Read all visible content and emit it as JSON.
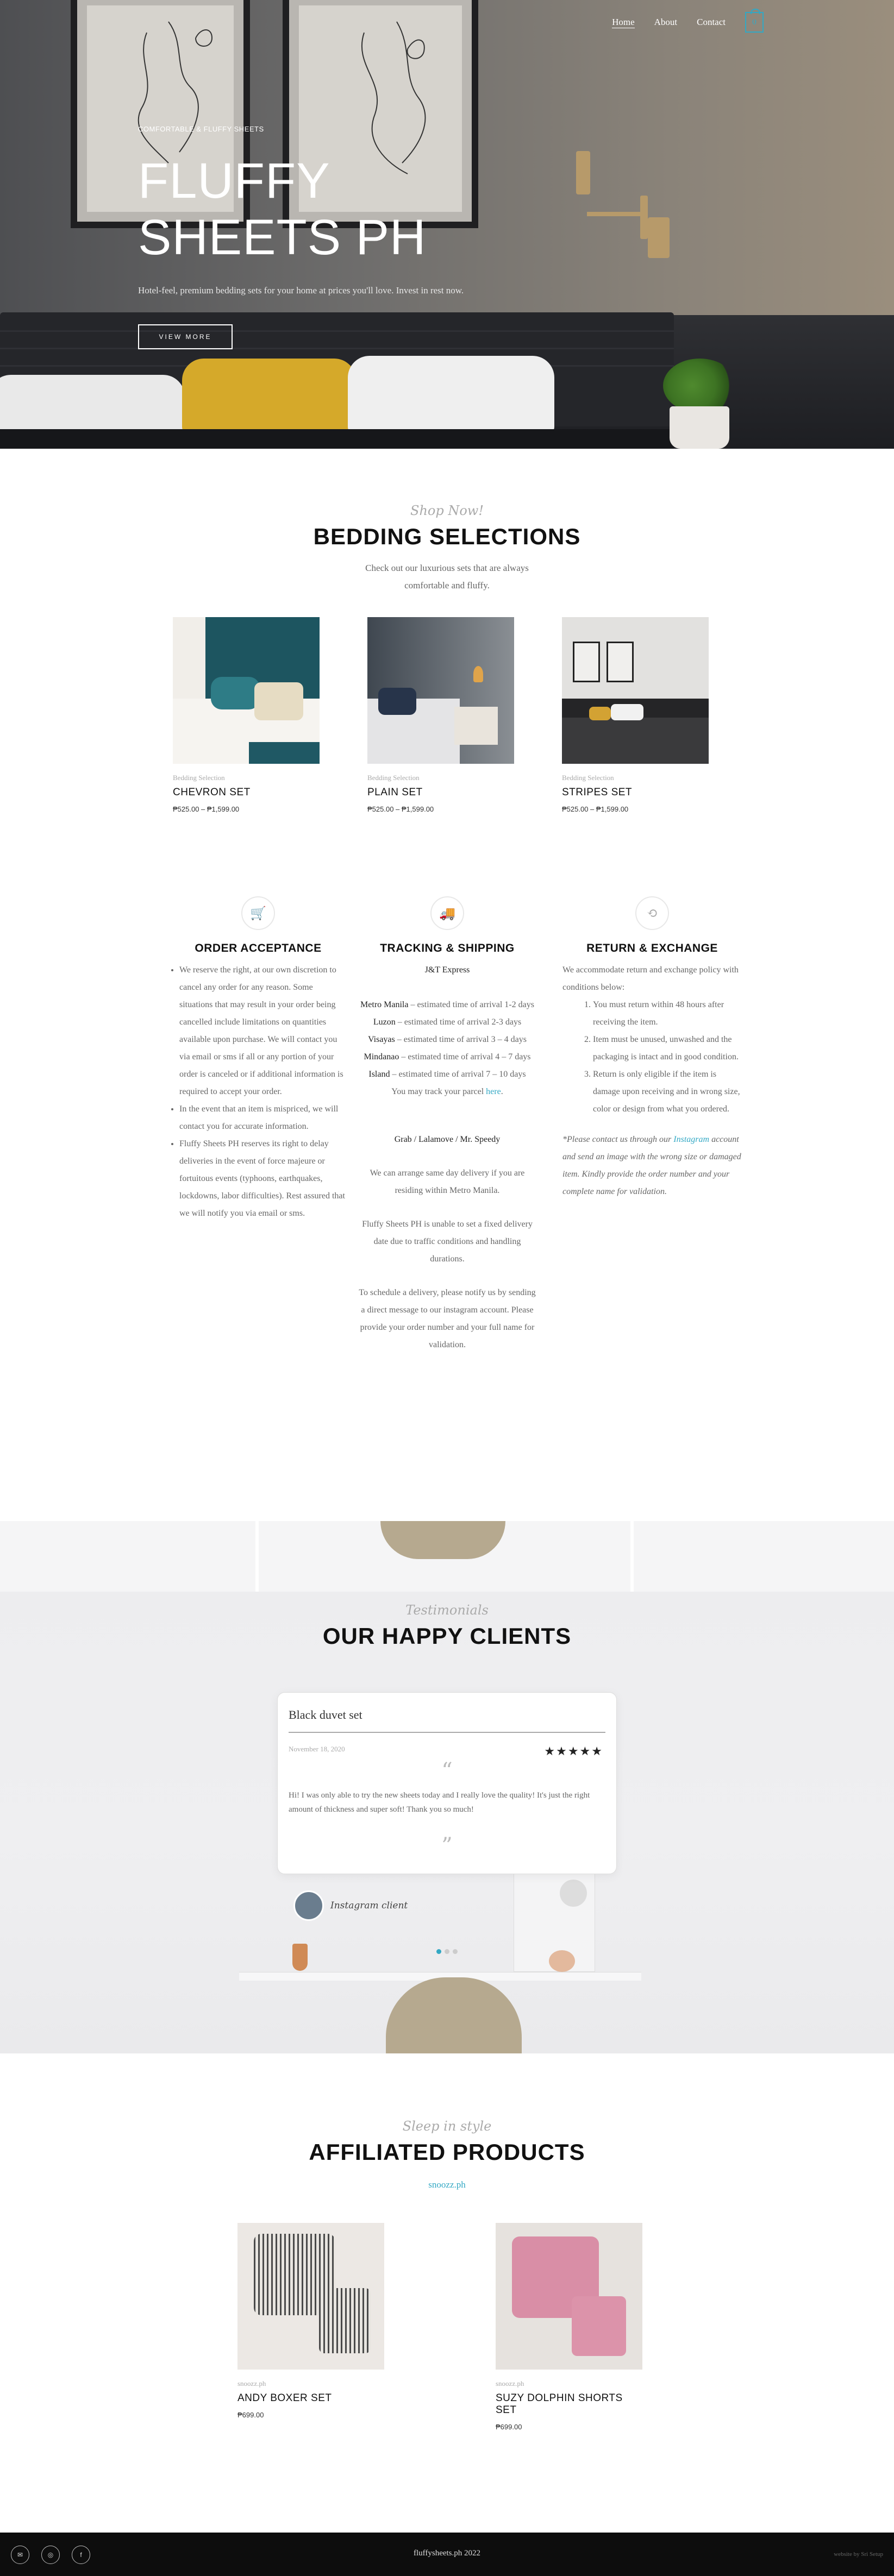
{
  "nav": {
    "items": [
      {
        "label": "Home"
      },
      {
        "label": "About"
      },
      {
        "label": "Contact"
      }
    ],
    "cart_count": "0"
  },
  "hero": {
    "eyebrow": "COMFORTABLE & FLUFFY SHEETS",
    "title": "FLUFFY SHEETS PH",
    "subtitle": "Hotel-feel, premium bedding sets for your home at prices you'll love. Invest in rest now.",
    "button": "VIEW MORE"
  },
  "bedding": {
    "kicker": "Shop Now!",
    "title": "BEDDING SELECTIONS",
    "description": "Check out our luxurious sets that are always comfortable and fluffy.",
    "products": [
      {
        "category": "Bedding Selection",
        "name": "CHEVRON SET",
        "price": "₱525.00 – ₱1,599.00"
      },
      {
        "category": "Bedding Selection",
        "name": "PLAIN SET",
        "price": "₱525.00 – ₱1,599.00"
      },
      {
        "category": "Bedding Selection",
        "name": "STRIPES SET",
        "price": "₱525.00 – ₱1,599.00"
      }
    ]
  },
  "policies": {
    "order": {
      "title": "ORDER ACCEPTANCE",
      "icon": "cart-icon",
      "bullets": [
        "We reserve the right, at our own discretion to cancel any order for any reason. Some situations that may result in your order being cancelled include limitations on quantities available upon purchase. We will contact you via email or sms if all or any portion of your order is canceled or if additional information is required to accept your order.",
        "In the event that an item is mispriced, we will contact you for accurate information.",
        "Fluffy Sheets PH reserves its right to delay deliveries in the event of force majeure or fortuitous events (typhoons, earthquakes, lockdowns, labor difficulties). Rest assured that we will notify you via email or sms."
      ]
    },
    "shipping": {
      "title": "TRACKING & SHIPPING",
      "icon": "truck-icon",
      "courier": "J&T Express",
      "areas": [
        {
          "area": "Metro Manila",
          "eta": " – estimated time of arrival 1-2 days"
        },
        {
          "area": "Luzon",
          "eta": " – estimated time of arrival 2-3 days"
        },
        {
          "area": "Visayas",
          "eta": " – estimated time of arrival 3 – 4 days"
        },
        {
          "area": "Mindanao",
          "eta": " – estimated time of arrival 4 – 7 days"
        },
        {
          "area": "Island",
          "eta": " – estimated time of arrival 7 – 10 days"
        }
      ],
      "track_text": "You may track your parcel ",
      "track_link": "here",
      "track_end": ".",
      "local_courier": "Grab / Lalamove / Mr. Speedy",
      "local_text": "We can arrange same day delivery if you are residing within Metro Manila.",
      "fixed_text": "Fluffy Sheets PH is unable to set a fixed delivery date due to traffic conditions and handling durations.",
      "schedule_text": "To schedule a delivery, please notify us by sending a direct message to our instagram account. Please provide your order number and your full name for validation."
    },
    "returns": {
      "title": "RETURN & EXCHANGE",
      "icon": "return-icon",
      "intro": "We accommodate return and exchange policy with conditions below:",
      "conditions": [
        "You must return within 48 hours after receiving the item.",
        "Item must be unused, unwashed and the packaging is intact and in good condition.",
        "Return is only eligible if the item is damage upon receiving and in wrong size, color or design from what you ordered."
      ],
      "note_start": "*Please contact us through our ",
      "note_link": "Instagram",
      "note_end": " account and send an image with the wrong size or damaged item. Kindly provide the order number and your complete name for validation."
    }
  },
  "testimonials": {
    "kicker": "Testimonials",
    "title": "OUR HAPPY CLIENTS",
    "review": {
      "title": "Black duvet set",
      "date": "November 18, 2020",
      "rating": 5,
      "stars": "★★★★★",
      "text": "Hi! I was only able to try the new sheets today and I really love the quality! It's just the right amount of thickness and super soft! Thank you so much!"
    },
    "author": "Instagram client",
    "slides": 3,
    "active_slide": 0
  },
  "affiliated": {
    "kicker": "Sleep in style",
    "title": "AFFILIATED PRODUCTS",
    "link": "snoozz.ph",
    "products": [
      {
        "category": "snoozz.ph",
        "name": "ANDY BOXER SET",
        "price": "₱699.00"
      },
      {
        "category": "snoozz.ph",
        "name": "SUZY DOLPHIN SHORTS SET",
        "price": "₱699.00"
      }
    ]
  },
  "footer": {
    "copyright": "fluffysheets.ph 2022",
    "credit": "website by Sri Setup",
    "socials": [
      {
        "icon": "email-icon",
        "glyph": "✉"
      },
      {
        "icon": "instagram-icon",
        "glyph": "◎"
      },
      {
        "icon": "facebook-icon",
        "glyph": "f"
      }
    ]
  },
  "colors": {
    "accent": "#32a8c4",
    "footer_bg": "#0d0d0d",
    "heading": "#111111"
  }
}
